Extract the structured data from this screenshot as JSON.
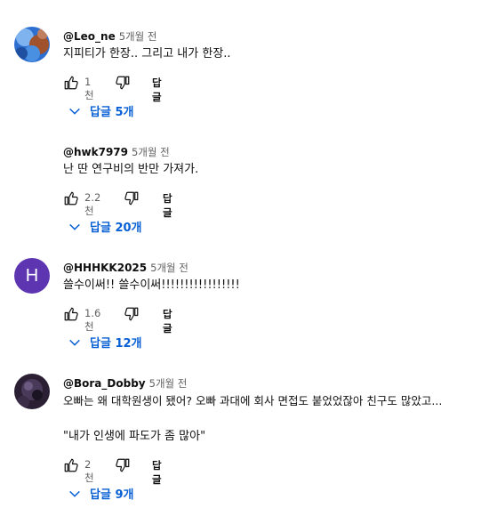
{
  "comments": [
    {
      "author": "@Leo_ne",
      "time": "5개월 전",
      "lines": [
        "지피티가 한장.. 그리고 내가 한장.."
      ],
      "likes": "1천",
      "reply_label": "답글",
      "replies_label": "답글 5개",
      "avatar_icon": "photo-avatar-blue"
    },
    {
      "author": "@hwk7979",
      "time": "5개월 전",
      "lines": [
        "난 딴 연구비의 반만 가져가."
      ],
      "likes": "2.2천",
      "reply_label": "답글",
      "replies_label": "답글 20개",
      "avatar_icon": "none"
    },
    {
      "author": "@HHHKK2025",
      "time": "5개월 전",
      "lines": [
        "쓸수이써!! 쓸수이써!!!!!!!!!!!!!!!!!"
      ],
      "likes": "1.6천",
      "reply_label": "답글",
      "replies_label": "답글 12개",
      "avatar_letter": "H",
      "avatar_color": "#5e35b1"
    },
    {
      "author": "@Bora_Dobby",
      "time": "5개월 전",
      "lines": [
        "오빠는 왜 대학원생이 됐어? 오빠 과대에 회사 면접도 붙었었잖아 친구도 많았고...",
        "\"내가 인생에 파도가 좀 많아\""
      ],
      "likes": "2천",
      "reply_label": "답글",
      "replies_label": "답글 9개",
      "avatar_icon": "photo-avatar-dark-purple"
    }
  ],
  "colors": {
    "link_blue": "#065fd4",
    "secondary_text": "#606060"
  }
}
